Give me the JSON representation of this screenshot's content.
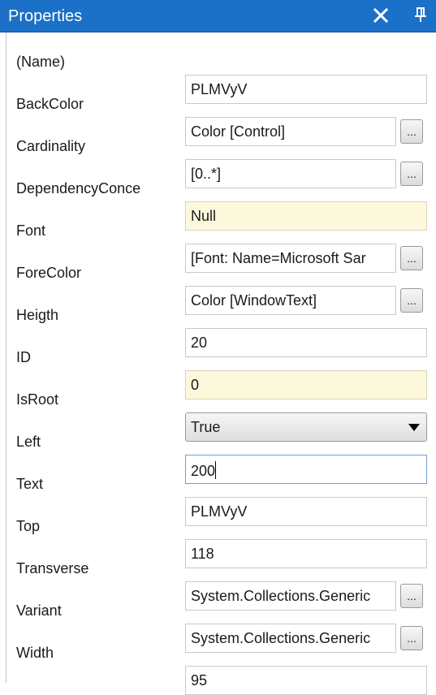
{
  "window": {
    "title": "Properties"
  },
  "properties": [
    {
      "name": "(Name)",
      "value": "PLMVyV"
    },
    {
      "name": "BackColor",
      "value": "Color [Control]",
      "button": "..."
    },
    {
      "name": "Cardinality",
      "value": "[0..*]",
      "button": "..."
    },
    {
      "name": "DependencyConce",
      "value": "Null"
    },
    {
      "name": "Font",
      "value": "[Font: Name=Microsoft Sar",
      "button": "..."
    },
    {
      "name": "ForeColor",
      "value": "Color [WindowText]",
      "button": "..."
    },
    {
      "name": "Heigth",
      "value": "20"
    },
    {
      "name": "ID",
      "value": "0"
    },
    {
      "name": "IsRoot",
      "value": "True"
    },
    {
      "name": "Left",
      "value": "200"
    },
    {
      "name": "Text",
      "value": "PLMVyV"
    },
    {
      "name": "Top",
      "value": "118"
    },
    {
      "name": "Transverse",
      "value": "System.Collections.Generic",
      "button": "..."
    },
    {
      "name": "Variant",
      "value": "System.Collections.Generic",
      "button": "..."
    },
    {
      "name": "Width",
      "value": "95"
    }
  ],
  "colors": {
    "titlebar": "#1b70c7",
    "readonly_background": "#fbf8dc"
  },
  "icons": {
    "close": "close-icon",
    "pin": "pin-icon",
    "dropdown": "chevron-down-icon"
  }
}
